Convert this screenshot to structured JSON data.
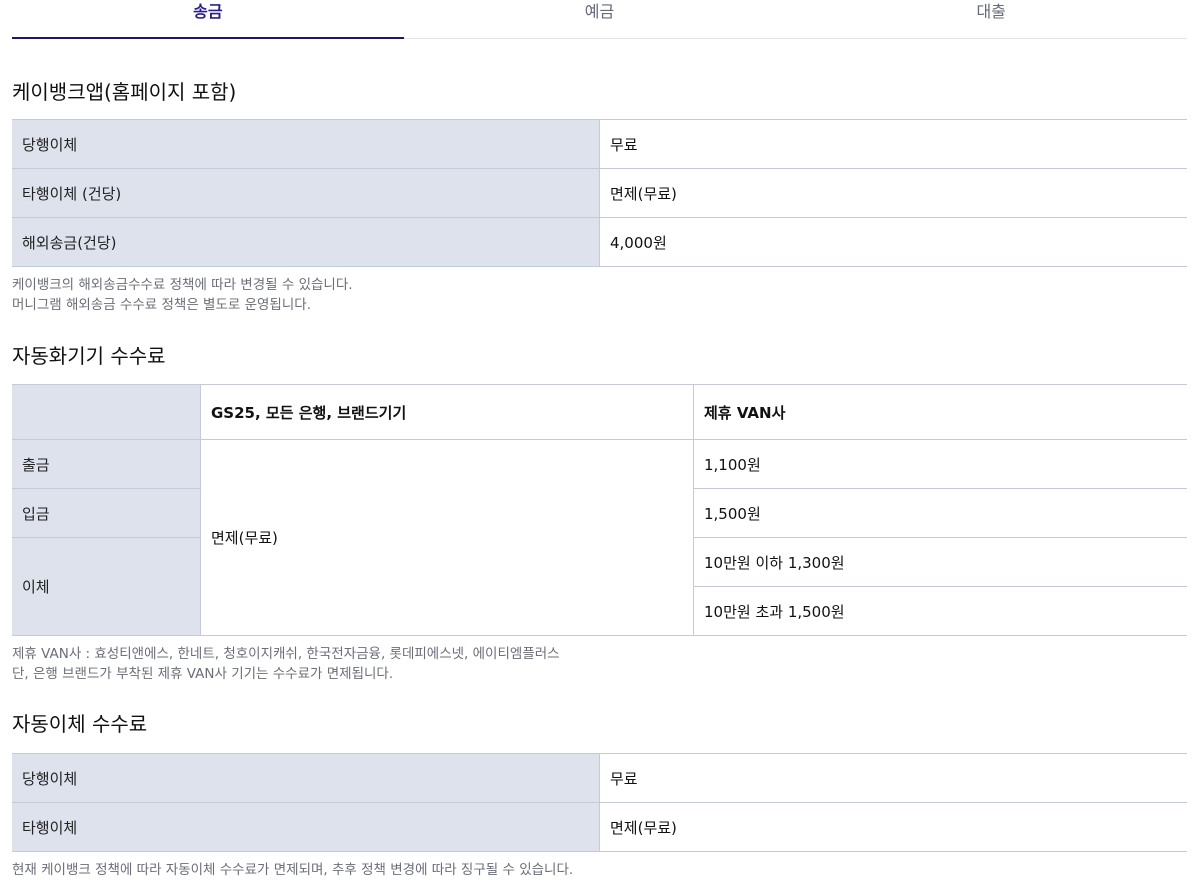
{
  "tabs": [
    {
      "label": "송금",
      "active": true
    },
    {
      "label": "예금",
      "active": false
    },
    {
      "label": "대출",
      "active": false
    }
  ],
  "section1": {
    "title": "케이뱅크앱(홈페이지 포함)",
    "rows": [
      {
        "label": "당행이체",
        "value": "무료"
      },
      {
        "label": "타행이체 (건당)",
        "value": "면제(무료)"
      },
      {
        "label": "해외송금(건당)",
        "value": "4,000원"
      }
    ],
    "notes": [
      "케이뱅크의 해외송금수수료 정책에 따라 변경될 수 있습니다.",
      "머니그램 해외송금 수수료 정책은 별도로 운영됩니다."
    ]
  },
  "section2": {
    "title": "자동화기기 수수료",
    "header": {
      "corner": "",
      "col1": "GS25, 모든 은행, 브랜드기기",
      "col2": "제휴 VAN사"
    },
    "row_labels": {
      "withdraw": "출금",
      "deposit": "입금",
      "transfer": "이체"
    },
    "col1_value": "면제(무료)",
    "col2_values": {
      "withdraw": "1,100원",
      "deposit": "1,500원",
      "transfer_under": "10만원 이하 1,300원",
      "transfer_over": "10만원 초과 1,500원"
    },
    "notes": [
      "제휴 VAN사 : 효성티앤에스, 한네트, 청호이지캐쉬, 한국전자금융, 롯데피에스넷, 에이티엠플러스",
      "단, 은행 브랜드가 부착된 제휴 VAN사 기기는 수수료가 면제됩니다."
    ]
  },
  "section3": {
    "title": "자동이체 수수료",
    "rows": [
      {
        "label": "당행이체",
        "value": "무료"
      },
      {
        "label": "타행이체",
        "value": "면제(무료)"
      }
    ],
    "notes": [
      "현재 케이뱅크 정책에 따라 자동이체 수수료가 면제되며, 추후 정책 변경에 따라 징구될 수 있습니다."
    ]
  },
  "colors": {
    "accent": "#1d1670",
    "label_bg": "#dde2ec",
    "border": "#c5cad8",
    "note_text": "#6b6e78"
  }
}
